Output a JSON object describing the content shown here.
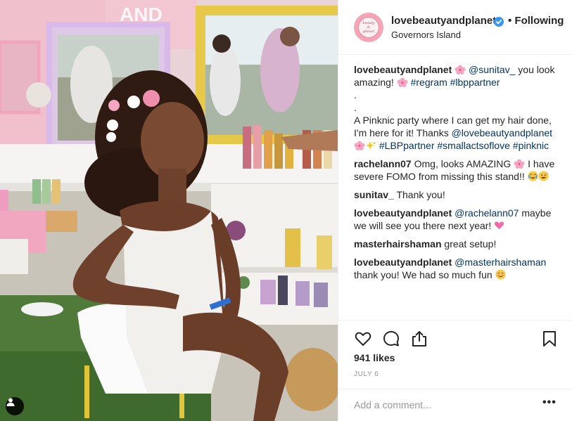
{
  "post": {
    "username": "lovebeautyandplanet",
    "follow_label": "Following",
    "location": "Governors Island",
    "avatar_text": [
      "beauty",
      "&",
      "planet"
    ]
  },
  "comments": [
    {
      "user": "lovebeautyandplanet",
      "parts": [
        "@sunitav_",
        "you look amazing!",
        "#regram",
        "#lbppartner",
        ".",
        ".",
        "A Pinknic party where I can get my hair done, I'm here for it! Thanks",
        "@lovebeautyandplanet",
        "#LBPpartner",
        "#smallactsoflove",
        "#pinknic"
      ]
    },
    {
      "user": "rachelann07",
      "text_a": "Omg, looks AMAZING",
      "text_b": "I have severe FOMO from missing this stand!!"
    },
    {
      "user": "sunitav_",
      "text": "Thank you!"
    },
    {
      "user": "lovebeautyandplanet",
      "mention": "@rachelann07",
      "text": "maybe we will see you there next year!"
    },
    {
      "user": "masterhairshaman",
      "text": "great setup!"
    },
    {
      "user": "lovebeautyandplanet",
      "mention": "@masterhairshaman",
      "text": "thank you! We had so much fun"
    }
  ],
  "likes": "941 likes",
  "date": "JULY 6",
  "add_comment_placeholder": "Add a comment...",
  "more_label": "•••",
  "colors": {
    "link": "#003569",
    "muted": "#999999",
    "divider": "#efefef",
    "verified": "#3897f0",
    "brand_pink": "#f4a6b7"
  },
  "icons": [
    "heart-icon",
    "comment-icon",
    "share-icon",
    "bookmark-icon",
    "verified-icon",
    "user-tag-icon",
    "ellipsis-icon"
  ]
}
